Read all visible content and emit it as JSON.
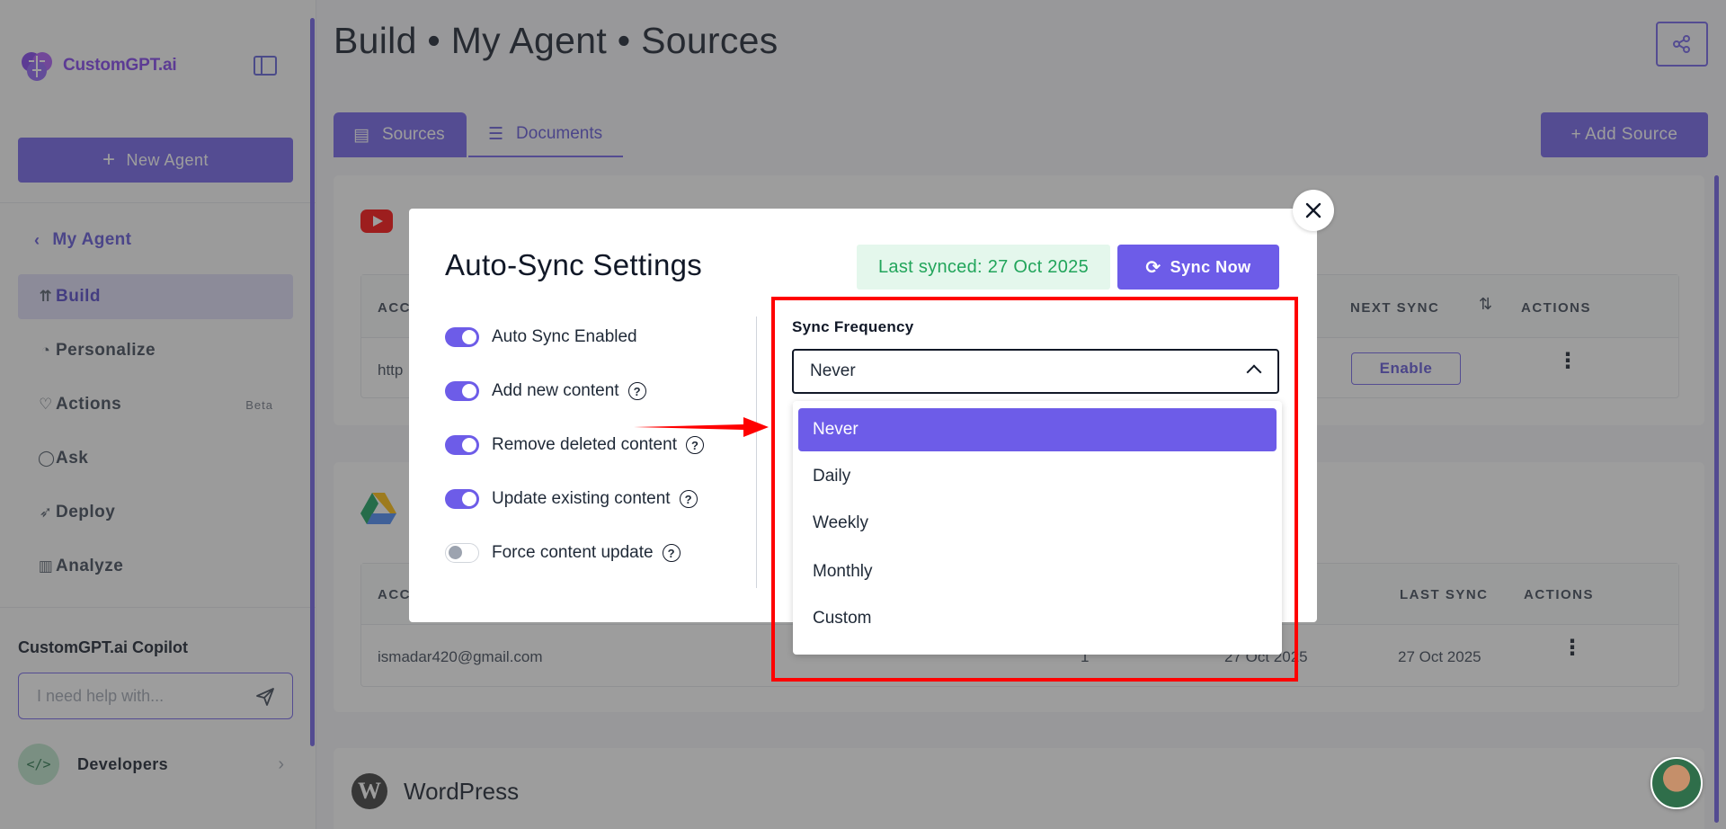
{
  "app": {
    "logo_text": "CustomGPT.ai"
  },
  "sidebar": {
    "new_agent": "New Agent",
    "back_label": "My Agent",
    "items": [
      {
        "label": "Build",
        "icon": "build-icon",
        "active": true
      },
      {
        "label": "Personalize",
        "icon": "palette-icon"
      },
      {
        "label": "Actions",
        "icon": "heart-icon",
        "badge": "Beta"
      },
      {
        "label": "Ask",
        "icon": "chat-icon"
      },
      {
        "label": "Deploy",
        "icon": "rocket-icon"
      },
      {
        "label": "Analyze",
        "icon": "chart-icon"
      }
    ],
    "copilot_title": "CustomGPT.ai Copilot",
    "copilot_placeholder": "I need help with...",
    "developers": "Developers"
  },
  "header": {
    "title": "Build • My Agent • Sources"
  },
  "tabs": {
    "sources": "Sources",
    "documents": "Documents"
  },
  "add_source": "Add Source",
  "youtube_table": {
    "headers": {
      "account": "ACC",
      "next_sync": "NEXT SYNC",
      "actions": "ACTIONS"
    },
    "row": {
      "account": "http",
      "enable": "Enable"
    }
  },
  "gdrive_table": {
    "headers": {
      "account": "ACC",
      "last_sync": "LAST SYNC",
      "actions": "ACTIONS"
    },
    "row": {
      "account": "ismadar420@gmail.com",
      "count": "1",
      "created": "27 Oct 2025",
      "last_sync": "27 Oct 2025"
    }
  },
  "wordpress_label": "WordPress",
  "modal": {
    "title": "Auto-Sync Settings",
    "last_synced": "Last synced: 27 Oct 2025",
    "sync_now": "Sync Now",
    "toggles": [
      {
        "label": "Auto Sync Enabled",
        "on": true,
        "help": false
      },
      {
        "label": "Add new content",
        "on": true,
        "help": true
      },
      {
        "label": "Remove deleted content",
        "on": true,
        "help": true
      },
      {
        "label": "Update existing content",
        "on": true,
        "help": true
      },
      {
        "label": "Force content update",
        "on": false,
        "help": true
      }
    ],
    "frequency_label": "Sync Frequency",
    "frequency_value": "Never",
    "options": [
      "Never",
      "Daily",
      "Weekly",
      "Monthly",
      "Custom"
    ]
  },
  "colors": {
    "accent": "#6d5ce8",
    "success_bg": "#e4f7ec",
    "success_text": "#22a55b",
    "annotation": "#ff0000"
  }
}
